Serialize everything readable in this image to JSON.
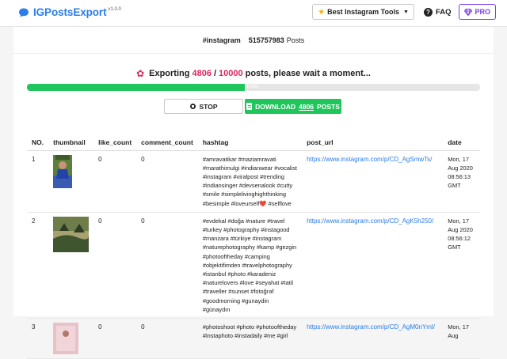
{
  "nav": {
    "brand": "IGPostsExport",
    "version": "v1.0.0",
    "tools_label": "Best Instagram Tools",
    "faq_label": "FAQ",
    "pro_label": "PRO"
  },
  "summary": {
    "tag": "#instagram",
    "count": "515757983",
    "unit": "Posts"
  },
  "export": {
    "prefix": "Exporting",
    "current": "4806",
    "separator": "/",
    "total": "10000",
    "suffix": "posts, please wait a moment...",
    "progress_percent": 48.06,
    "progress_label": "48.06%"
  },
  "buttons": {
    "stop": "STOP",
    "download_prefix": "DOWNLOAD",
    "download_count": "4806",
    "download_suffix": "POSTS"
  },
  "table": {
    "headers": [
      "NO.",
      "thumbnail",
      "like_count",
      "comment_count",
      "hashtag",
      "post_url",
      "date"
    ],
    "rows": [
      {
        "no": "1",
        "like": "0",
        "comment": "0",
        "hashtag": "#amravatikar #maziamravati #marathimulgi #indianwear #vocalist #instagram #viralpost #trending #indiansinger #devsenalook #cutty #smile #simplelivinghighthinking #besimple #loveurself",
        "hashtag_end": "#selflove",
        "url": "https://www.instagram.com/p/CD_AgSmwTs/",
        "date": "Mon, 17 Aug 2020 08:56:13 GMT"
      },
      {
        "no": "2",
        "like": "0",
        "comment": "0",
        "hashtag": "#evdekal #doğa #nature #travel #turkey #photography #instagood #manzara #türkiye #instagram #naturephotography #kamp #gezgin #photooftheday #camping #objektifimden #travelphotography #istanbul #photo #karadeniz #naturelovers #love #seyahat #tatil #traveller #sunset #fotoğraf #goodmorning #gunaydin #günaydın",
        "hashtag_end": "",
        "url": "https://www.instagram.com/p/CD_AgK5h250/",
        "date": "Mon, 17 Aug 2020 08:56:12 GMT"
      },
      {
        "no": "3",
        "like": "0",
        "comment": "0",
        "hashtag": "#photoshoot #photo #photooftheday #instaphoto #instadaily #me #girl",
        "hashtag_end": "",
        "url": "https://www.instagram.com/p/CD_AgM0nYml/",
        "date": "Mon, 17 Aug"
      }
    ]
  },
  "colors": {
    "brand_blue": "#2b7de9",
    "accent_red": "#e0245e",
    "progress_green": "#20c55b",
    "pro_purple": "#7b3fe4"
  },
  "icons": [
    "chat-bubble-icon",
    "star-icon",
    "chevron-down-icon",
    "question-circle-icon",
    "diamond-icon",
    "gear-icon",
    "stop-circle-icon",
    "document-icon"
  ]
}
